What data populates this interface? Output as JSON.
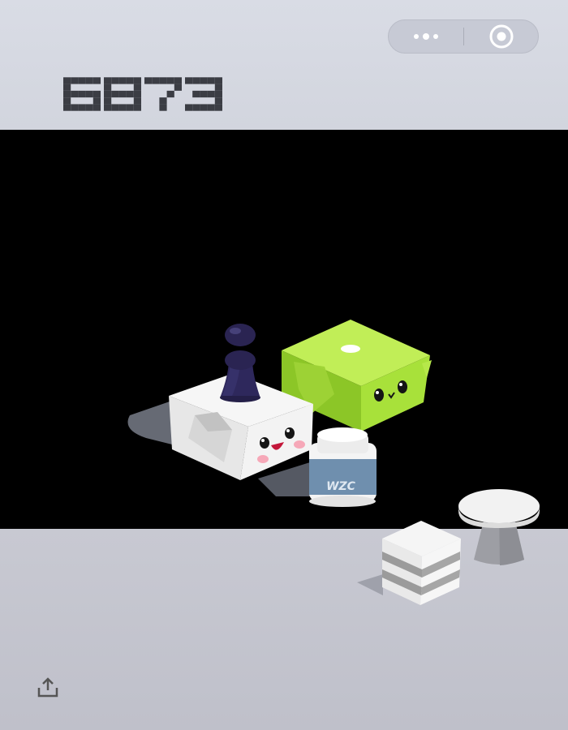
{
  "game": {
    "score": "6873",
    "jar_label": "WZC"
  },
  "capsule": {
    "more_icon": "more-dots-icon",
    "close_icon": "target-circle-icon"
  },
  "footer": {
    "share_icon": "share-upload-icon"
  },
  "colors": {
    "background_top": "#d9dce5",
    "background_bottom": "#bfc0ca",
    "score_digits": "#3b3d44",
    "green_box": "#a8e13a",
    "jar_label_bg": "#6f8fae",
    "player": "#2a2452"
  }
}
